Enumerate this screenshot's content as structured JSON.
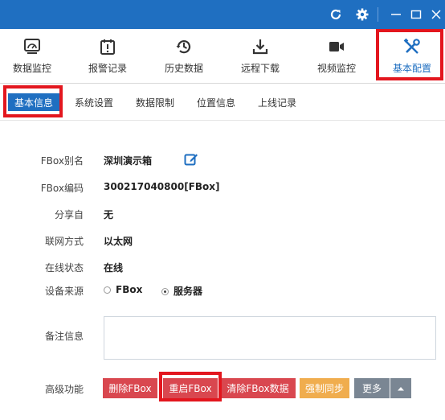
{
  "colors": {
    "titlebar": "#1f6fc1",
    "accent": "#1f6fc1",
    "highlight": "#e3161e",
    "danger": "#d9474f",
    "warning": "#f0ad4e",
    "gray": "#7a8693"
  },
  "titlebar": {
    "icons": [
      "refresh-icon",
      "gear-icon",
      "minimize-icon",
      "maximize-icon",
      "close-icon"
    ]
  },
  "nav": {
    "items": [
      {
        "label": "数据监控",
        "icon": "monitor-icon"
      },
      {
        "label": "报警记录",
        "icon": "alarm-icon"
      },
      {
        "label": "历史数据",
        "icon": "history-icon"
      },
      {
        "label": "远程下载",
        "icon": "download-icon"
      },
      {
        "label": "视频监控",
        "icon": "video-icon"
      },
      {
        "label": "基本配置",
        "icon": "tools-icon",
        "active": true
      }
    ]
  },
  "tabs": {
    "items": [
      {
        "label": "基本信息",
        "active": true
      },
      {
        "label": "系统设置"
      },
      {
        "label": "数据限制"
      },
      {
        "label": "位置信息"
      },
      {
        "label": "上线记录"
      }
    ]
  },
  "info": {
    "alias_label": "FBox别名",
    "alias_value": "深圳演示箱",
    "code_label": "FBox编码",
    "code_value": "300217040800[FBox]",
    "share_label": "分享自",
    "share_value": "无",
    "network_label": "联网方式",
    "network_value": "以太网",
    "status_label": "在线状态",
    "status_value": "在线",
    "source_label": "设备来源",
    "source_options": [
      {
        "label": "FBox",
        "checked": false
      },
      {
        "label": "服务器",
        "checked": true
      }
    ],
    "notes_label": "备注信息",
    "notes_value": "",
    "advanced_label": "高级功能"
  },
  "actions": {
    "delete": "删除FBox",
    "restart": "重启FBox",
    "clear": "清除FBox数据",
    "sync": "强制同步",
    "more": "更多"
  }
}
